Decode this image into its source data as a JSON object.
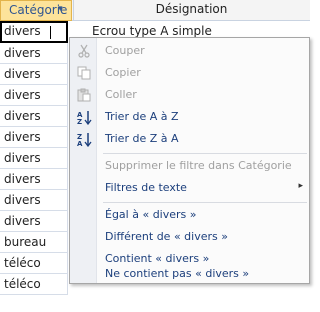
{
  "header": {
    "category_label": "Catégorie",
    "filter_arrow": "▾",
    "designation_label": "Désignation"
  },
  "rows": [
    "divers",
    "divers",
    "divers",
    "divers",
    "divers",
    "divers",
    "divers",
    "divers",
    "divers",
    "divers",
    "bureau",
    "téléco",
    "téléco"
  ],
  "partial_cell": "Ecrou type A simple",
  "menu": {
    "cut": "Couper",
    "copy": "Copier",
    "paste": "Coller",
    "sort_az": "Trier de A à Z",
    "sort_za": "Trier de Z à A",
    "clear_filter": "Supprimer le filtre dans Catégorie",
    "text_filters": "Filtres de texte",
    "submenu_arrow": "▸",
    "equals": "Égal à « divers »",
    "not_equals": "Différent de « divers »",
    "contains": "Contient « divers »",
    "not_contains": "Ne contient pas « divers »"
  },
  "icons": {
    "cut": "scissors-icon",
    "copy": "copy-icon",
    "paste": "paste-icon",
    "sort_az": "sort-ascending-icon",
    "sort_za": "sort-descending-icon"
  },
  "colors": {
    "header_active": "#fde39a",
    "menu_text": "#1c3f7c",
    "disabled_text": "#a0a0a0"
  }
}
